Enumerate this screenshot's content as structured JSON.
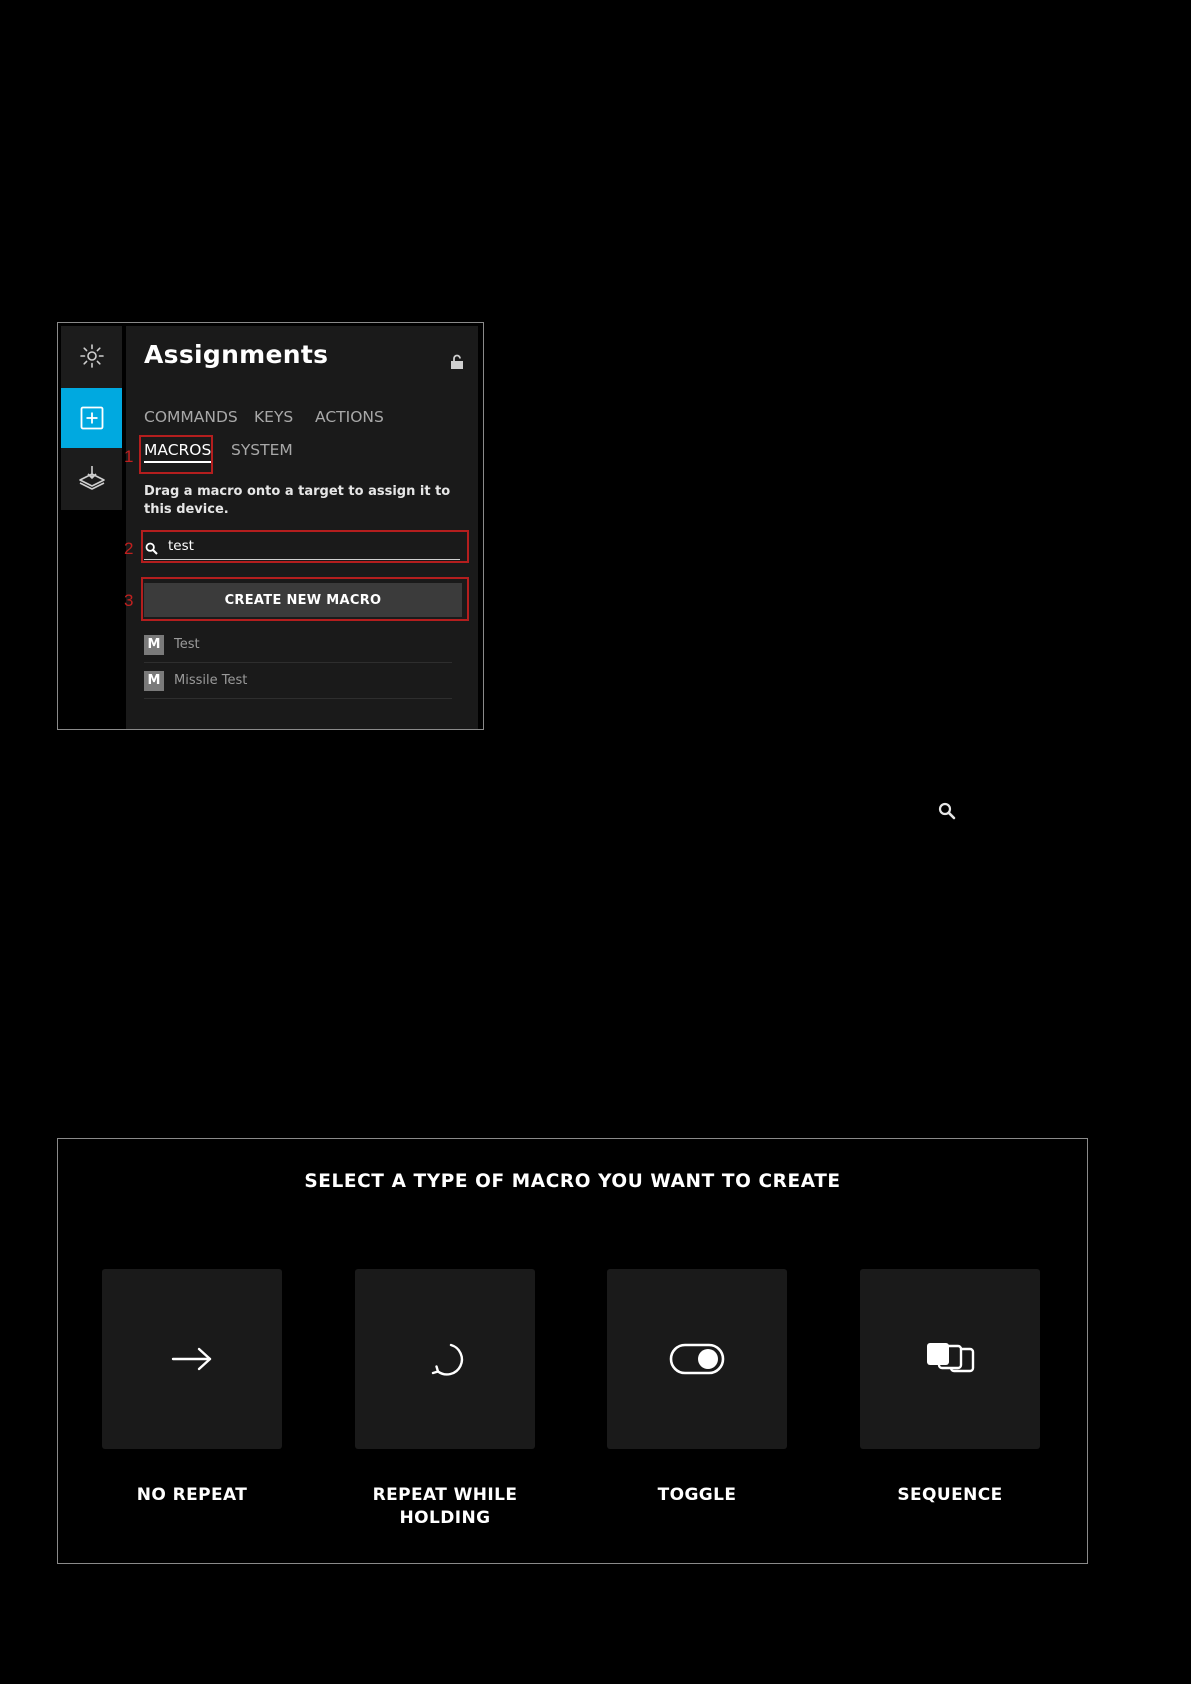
{
  "assignments": {
    "title": "Assignments",
    "tabs": [
      "COMMANDS",
      "KEYS",
      "ACTIONS",
      "MACROS",
      "SYSTEM"
    ],
    "active_tab": "MACROS",
    "hint": "Drag a macro onto a target to assign it to this device.",
    "search": {
      "value": "test"
    },
    "create_button": "CREATE NEW MACRO",
    "macros": [
      {
        "badge": "M",
        "name": "Test"
      },
      {
        "badge": "M",
        "name": "Missile Test"
      }
    ],
    "callouts": [
      "1",
      "2",
      "3"
    ],
    "accent_color": "#00a9e0",
    "callout_color": "#b41e1e"
  },
  "dialog": {
    "title": "SELECT A TYPE OF MACRO YOU WANT TO CREATE",
    "types": [
      {
        "label": "NO REPEAT",
        "icon": "arrow-right-icon"
      },
      {
        "label": "REPEAT WHILE HOLDING",
        "icon": "repeat-icon"
      },
      {
        "label": "TOGGLE",
        "icon": "toggle-icon"
      },
      {
        "label": "SEQUENCE",
        "icon": "sequence-icon"
      }
    ]
  }
}
